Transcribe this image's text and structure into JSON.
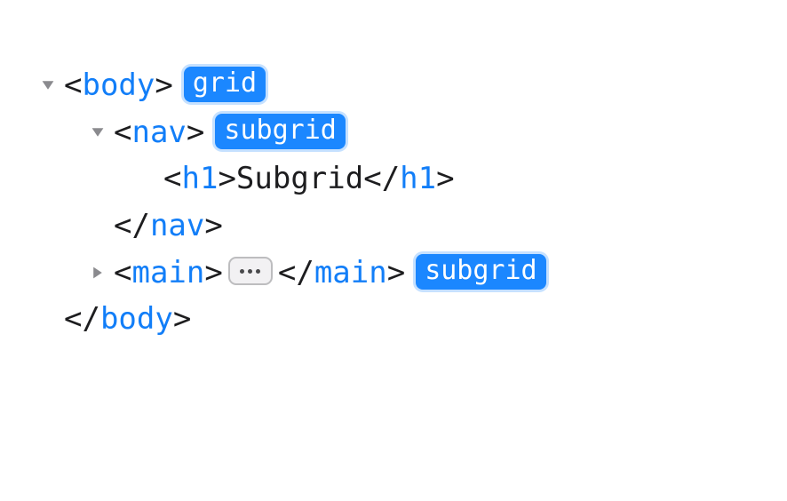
{
  "tree": {
    "body": {
      "open": "body",
      "close": "body",
      "badge": "grid"
    },
    "nav": {
      "open": "nav",
      "close": "nav",
      "badge": "subgrid"
    },
    "h1": {
      "open": "h1",
      "close": "h1",
      "text": "Subgrid"
    },
    "main": {
      "open": "main",
      "close": "main",
      "badge": "subgrid"
    }
  },
  "glyphs": {
    "lt": "<",
    "gt": ">",
    "lts": "</"
  }
}
